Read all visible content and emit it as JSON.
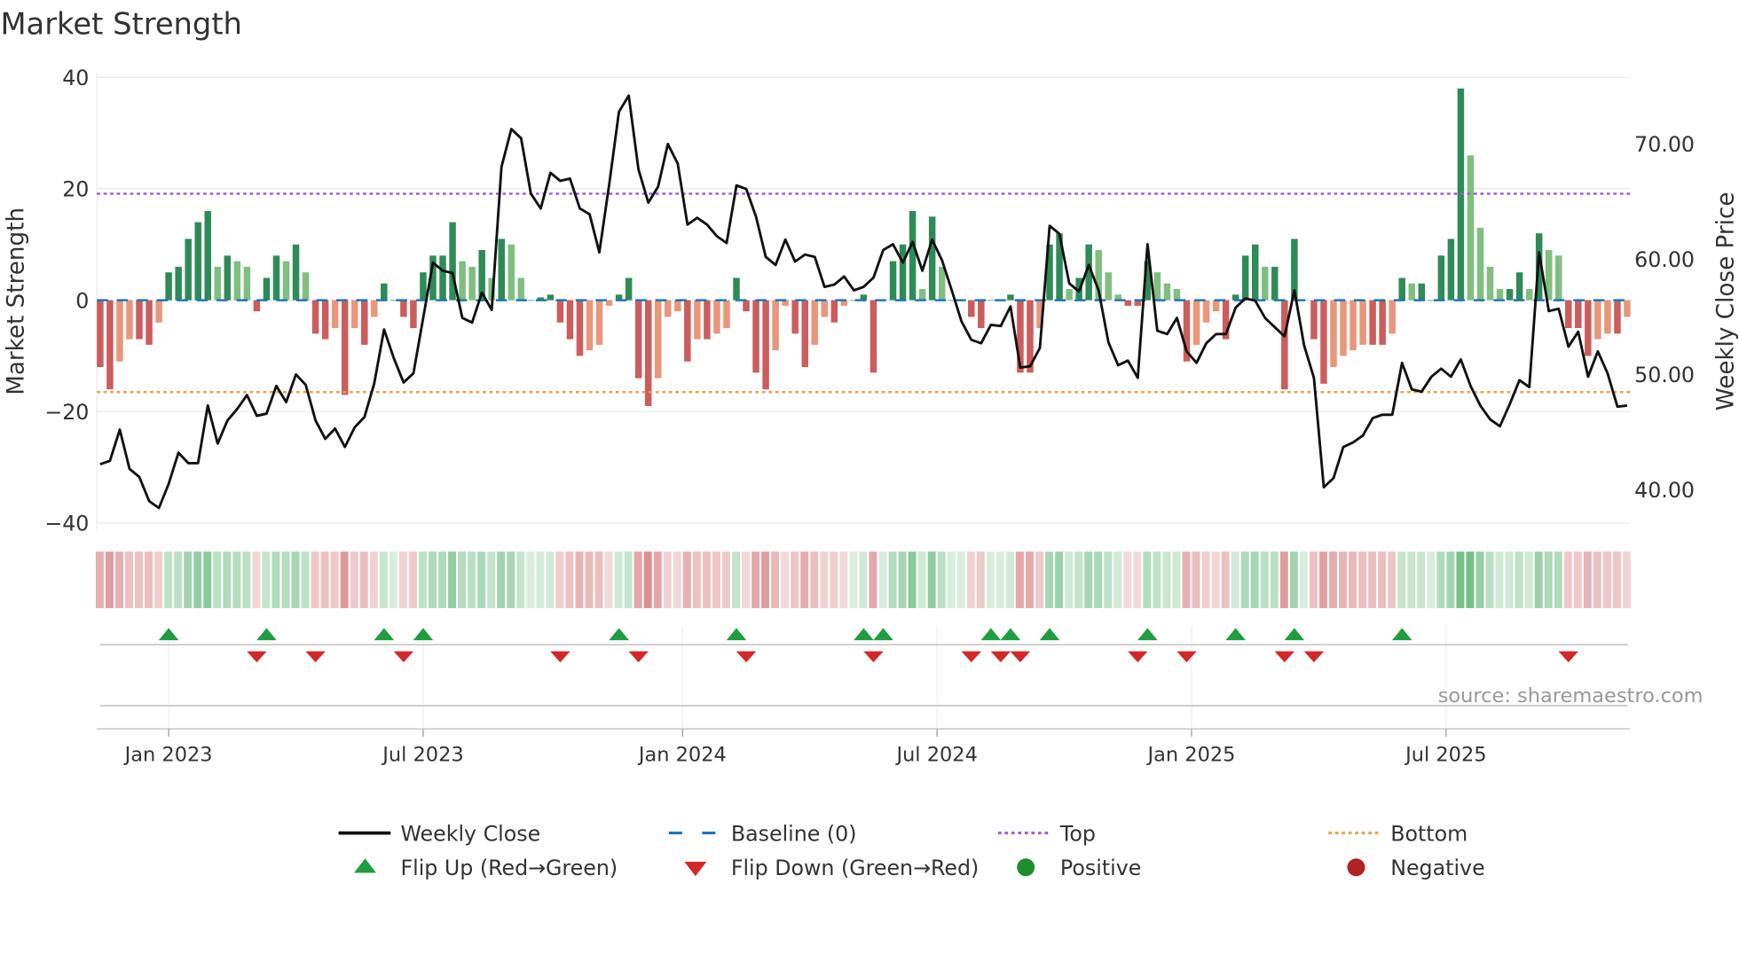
{
  "chart_data": {
    "type": "bar",
    "title": "Market Strength",
    "ylabel": "Market Strength",
    "y2label": "Weekly Close Price",
    "ylim": [
      -40,
      40
    ],
    "y2lim": [
      37,
      75
    ],
    "yticks": [
      "40",
      "20",
      "0",
      "−20",
      "−40"
    ],
    "ytick_values": [
      40,
      20,
      0,
      -20,
      -40
    ],
    "y2ticks": [
      "70.00",
      "60.00",
      "50.00",
      "40.00"
    ],
    "y2tick_values": [
      70,
      60,
      50,
      40
    ],
    "xticks": [
      "Jan 2023",
      "Jul 2023",
      "Jan 2024",
      "Jul 2024",
      "Jan 2025",
      "Jul 2025"
    ],
    "xtick_week_index": [
      7,
      33,
      59.5,
      85.5,
      111.5,
      137.5
    ],
    "top_level": 19.1,
    "bottom_level": -16.5,
    "strength": [
      -12,
      -16,
      -11,
      -7,
      -7,
      -8,
      -4,
      5,
      6,
      11,
      14,
      16,
      6,
      8,
      7,
      6,
      -2,
      4,
      8,
      7,
      10,
      5,
      -6,
      -7,
      -5,
      -17,
      -5,
      -8,
      -3,
      3,
      0,
      -3,
      -5,
      5,
      8,
      8,
      14,
      7,
      6,
      9,
      4,
      11,
      10,
      4,
      0,
      0.5,
      1,
      -4,
      -7,
      -10,
      -9,
      -8,
      -1,
      1,
      4,
      -14,
      -19,
      -14,
      -3,
      -2,
      -11,
      -7,
      -7,
      -6,
      -5,
      4,
      -2,
      -13,
      -16,
      -9,
      -1,
      -6,
      -12,
      -8,
      -3,
      -4,
      -1,
      0,
      1,
      -13,
      0,
      7,
      10,
      16,
      2,
      15,
      6,
      0,
      0,
      -3,
      -5,
      0,
      0,
      1,
      -13,
      -13,
      -5,
      10,
      12,
      2,
      4,
      10,
      9,
      5,
      1,
      -1,
      -1,
      7,
      5,
      3,
      2,
      -11,
      -8,
      -4,
      -2,
      -7,
      1,
      8,
      10,
      6,
      6,
      -16,
      11,
      0,
      -7,
      -15,
      -12,
      -10,
      -9,
      -8,
      -8,
      -8,
      -6,
      4,
      3,
      3,
      0,
      8,
      11,
      38,
      26,
      13,
      6,
      2,
      2,
      5,
      2,
      12,
      9,
      8,
      -5,
      -5,
      -10,
      -7,
      -6,
      -6,
      -3
    ],
    "weekly_close": [
      42.2,
      42.5,
      45.2,
      41.8,
      41.1,
      39.0,
      38.4,
      40.5,
      43.2,
      42.3,
      42.3,
      47.3,
      44.0,
      46.0,
      47.0,
      48.2,
      46.4,
      46.6,
      49.0,
      47.6,
      50.0,
      49.1,
      46.0,
      44.4,
      45.3,
      43.7,
      45.4,
      46.3,
      49.2,
      53.9,
      51.4,
      49.3,
      50.1,
      54.9,
      59.7,
      59.0,
      58.8,
      54.9,
      54.5,
      57.1,
      55.6,
      68.0,
      71.3,
      70.5,
      65.7,
      64.4,
      67.5,
      66.8,
      67.0,
      64.4,
      63.9,
      60.6,
      66.5,
      72.8,
      74.2,
      67.8,
      64.9,
      66.3,
      70.0,
      68.3,
      63.0,
      63.6,
      63.0,
      62.0,
      61.4,
      66.4,
      66.1,
      63.7,
      60.2,
      59.5,
      61.7,
      59.8,
      60.4,
      60.2,
      57.6,
      57.8,
      58.5,
      57.3,
      57.6,
      58.4,
      60.8,
      61.3,
      59.7,
      61.5,
      59.0,
      61.7,
      59.9,
      57.3,
      54.6,
      53.0,
      52.7,
      54.3,
      54.2,
      55.9,
      50.6,
      50.7,
      52.3,
      62.9,
      62.2,
      57.9,
      57.2,
      59.5,
      57.3,
      52.8,
      50.8,
      51.2,
      49.7,
      61.3,
      53.8,
      53.5,
      54.9,
      52.0,
      51.0,
      52.7,
      53.5,
      53.5,
      55.8,
      56.6,
      56.4,
      54.9,
      54.1,
      53.3,
      57.3,
      52.5,
      49.7,
      40.2,
      41.0,
      43.7,
      44.1,
      44.7,
      46.2,
      46.5,
      46.5,
      51.0,
      48.7,
      48.5,
      49.8,
      50.5,
      49.8,
      51.3,
      49.0,
      47.3,
      46.1,
      45.5,
      47.4,
      49.5,
      48.9,
      60.6,
      55.5,
      55.7,
      52.4,
      53.7,
      49.8,
      52.0,
      50.1,
      47.2,
      47.3
    ],
    "flip_up_weeks": [
      7,
      17,
      29,
      33,
      53,
      65,
      78,
      80,
      91,
      93,
      97,
      107,
      116,
      122,
      133
    ],
    "flip_down_weeks": [
      16,
      22,
      31,
      47,
      55,
      66,
      79,
      89,
      92,
      94,
      106,
      111,
      121,
      124,
      150
    ],
    "legend": [
      {
        "label": "Weekly Close",
        "marker": "line"
      },
      {
        "label": "Baseline (0)",
        "marker": "dashed"
      },
      {
        "label": "Top",
        "marker": "dotted-purple"
      },
      {
        "label": "Bottom",
        "marker": "dotted-orange"
      },
      {
        "label": "Flip Up (Red→Green)",
        "marker": "triangle-up"
      },
      {
        "label": "Flip Down (Green→Red)",
        "marker": "triangle-down"
      },
      {
        "label": "Positive",
        "marker": "dot-green"
      },
      {
        "label": "Negative",
        "marker": "dot-red"
      }
    ],
    "legend_position": "bottom",
    "grid": true
  },
  "source": "source: sharemaestro.com",
  "colors": {
    "pos_strong": "#2e8b57",
    "pos_weak": "#7fbf7f",
    "neg_strong": "#cd5c5c",
    "neg_weak": "#e9967a",
    "top": "#9d5fe0",
    "bottom": "#f0a050",
    "baseline": "#1f77b4",
    "flip_up": "#1e9e3e",
    "flip_down": "#d62728",
    "positive": "#1e8c2a",
    "negative": "#b22222",
    "close": "#111111"
  }
}
